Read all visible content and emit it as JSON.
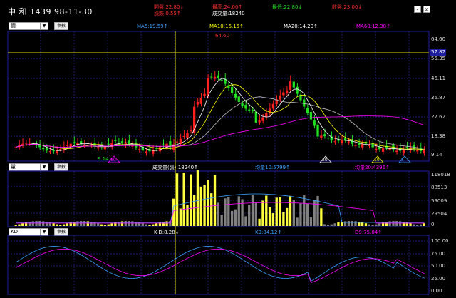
{
  "header": {
    "title": "中 和 1439 98-11-30",
    "open": "開盤:22.80↓",
    "high": "最高:24.00↑",
    "low": "最低:22.80↓",
    "close": "收盤:23.00↓",
    "change": "漲跌:0.55↑",
    "volume": "成交量:18240",
    "min_label": "-",
    "max_label": "×"
  },
  "price_panel": {
    "select_value": "價",
    "params_label": "參數",
    "ma5": "MA5:19.59↑",
    "ma10": "MA10:16.15↑",
    "ma20": "MA20:14.20↑",
    "ma60": "MA60:12.38↑",
    "y_ticks": [
      "64.60",
      "57.82",
      "55.35",
      "46.11",
      "36.87",
      "27.62",
      "18.38",
      "9.14"
    ],
    "peak_label": "64.60",
    "low_label": "9.14",
    "markers": [
      "60",
      "20",
      "10",
      "5"
    ]
  },
  "volume_panel": {
    "select_value": "量",
    "params_label": "參數",
    "volume": "成交量(張):18240↑",
    "ma10": "均量10:5799↑",
    "ma20": "均量20:4396↑",
    "y_ticks": [
      "118018",
      "88513",
      "59009",
      "29504",
      "0"
    ]
  },
  "kd_panel": {
    "select_value": "KD",
    "params_label": "參數",
    "kd": "K-D:8.28↓",
    "k": "K9:84.12↑",
    "d": "D9:75.84↑",
    "y_ticks": [
      "100.00",
      "75.00",
      "50.00",
      "25.00",
      "0.00"
    ]
  },
  "colors": {
    "up": "#ff2020",
    "down": "#20e020",
    "ma5": "#ffffff",
    "ma10": "#ffff00",
    "ma20": "#c0c0c0",
    "ma60": "#ff00ff",
    "frame": "#1e1ea0",
    "accent_blue": "#3ba0ff"
  }
}
